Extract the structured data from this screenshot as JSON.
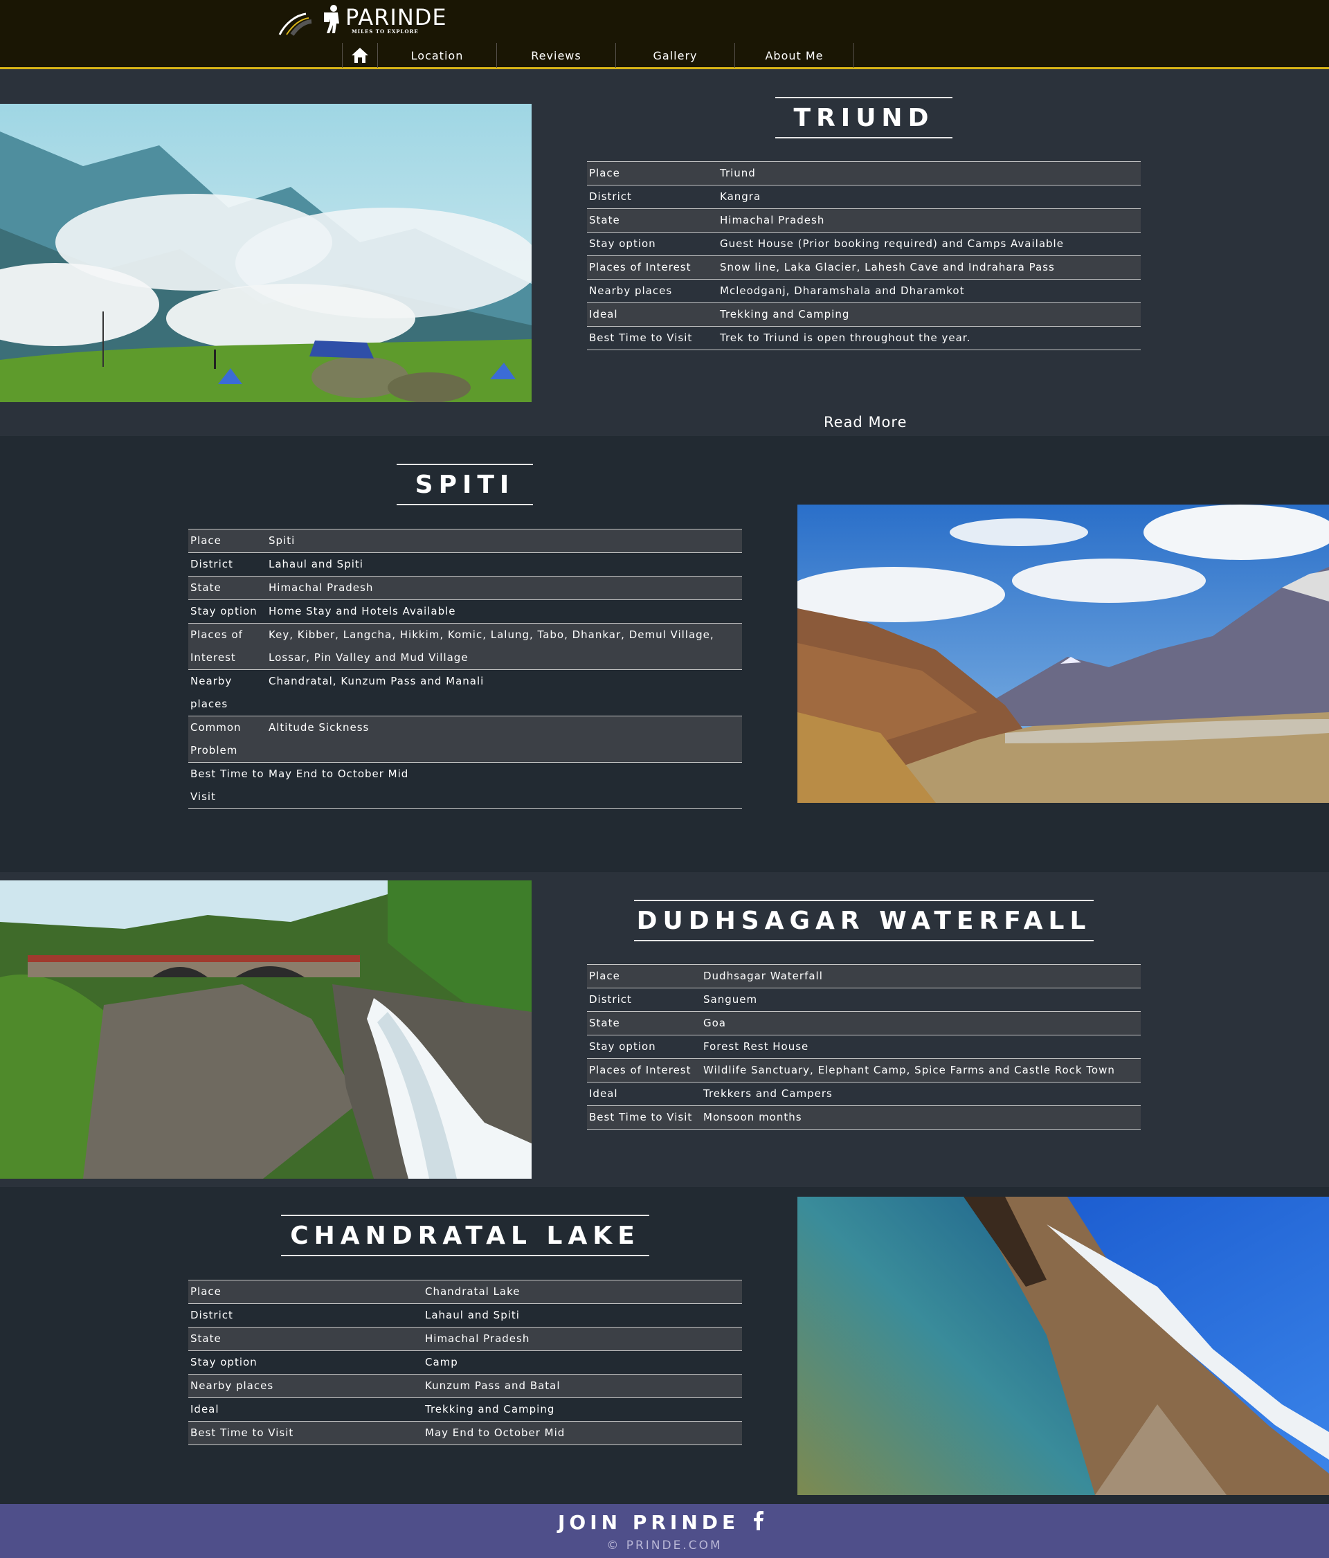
{
  "brand": {
    "name": "PARINDE",
    "tagline": "MILES TO EXPLORE"
  },
  "nav": {
    "home_icon": "home-icon",
    "items": [
      "Location",
      "Reviews",
      "Gallery",
      "About Me"
    ]
  },
  "colors": {
    "header_bg": "#1a1604",
    "accent": "#d7b317",
    "page_bg": "#2b323b",
    "footer_bg": "#4f4f8a"
  },
  "triund": {
    "title": "TRIUND",
    "rows": [
      {
        "label": "Place",
        "value": "Triund"
      },
      {
        "label": "District",
        "value": "Kangra"
      },
      {
        "label": "State",
        "value": "Himachal Pradesh"
      },
      {
        "label": "Stay option",
        "value": "Guest House (Prior booking required) and Camps Available"
      },
      {
        "label": "Places of Interest",
        "value": "Snow line, Laka Glacier, Lahesh Cave and Indrahara Pass"
      },
      {
        "label": "Nearby places",
        "value": "Mcleodganj, Dharamshala and Dharamkot"
      },
      {
        "label": "Ideal",
        "value": "Trekking and Camping"
      },
      {
        "label": "Best Time to Visit",
        "value": "Trek to Triund is open throughout the year."
      }
    ],
    "read_more": "Read More"
  },
  "spiti": {
    "title": "SPITI",
    "rows": [
      {
        "label": "Place",
        "value": "Spiti"
      },
      {
        "label": "District",
        "value": "Lahaul and Spiti"
      },
      {
        "label": "State",
        "value": "Himachal Pradesh"
      },
      {
        "label": "Stay option",
        "value": "Home Stay and Hotels Available"
      },
      {
        "label": "Places of Interest",
        "value": "Key, Kibber, Langcha, Hikkim, Komic, Lalung, Tabo, Dhankar, Demul Village, Lossar, Pin Valley and Mud Village"
      },
      {
        "label": "Nearby places",
        "value": "Chandratal, Kunzum Pass and Manali"
      },
      {
        "label": "Common Problem",
        "value": "Altitude Sickness"
      },
      {
        "label": "Best Time to Visit",
        "value": "May End to October Mid"
      }
    ]
  },
  "dudhsagar": {
    "title": "DUDHSAGAR WATERFALL",
    "rows": [
      {
        "label": "Place",
        "value": "Dudhsagar Waterfall"
      },
      {
        "label": "District",
        "value": "Sanguem"
      },
      {
        "label": "State",
        "value": "Goa"
      },
      {
        "label": "Stay option",
        "value": "Forest Rest House"
      },
      {
        "label": "Places of Interest",
        "value": "Wildlife Sanctuary, Elephant Camp, Spice Farms and Castle Rock Town"
      },
      {
        "label": "Ideal",
        "value": "Trekkers and Campers"
      },
      {
        "label": "Best Time to Visit",
        "value": "Monsoon months"
      }
    ]
  },
  "chandratal": {
    "title": "CHANDRATAL LAKE",
    "rows": [
      {
        "label": "Place",
        "value": "Chandratal Lake"
      },
      {
        "label": "District",
        "value": "Lahaul and Spiti"
      },
      {
        "label": "State",
        "value": "Himachal Pradesh"
      },
      {
        "label": "Stay option",
        "value": "Camp"
      },
      {
        "label": "Nearby places",
        "value": "Kunzum Pass and Batal"
      },
      {
        "label": "Ideal",
        "value": "Trekking and Camping"
      },
      {
        "label": "Best Time to Visit",
        "value": "May End to October Mid"
      }
    ]
  },
  "footer": {
    "join": "JOIN PRINDE",
    "social_icon": "facebook-icon",
    "copyright": "© PRINDE.COM"
  }
}
